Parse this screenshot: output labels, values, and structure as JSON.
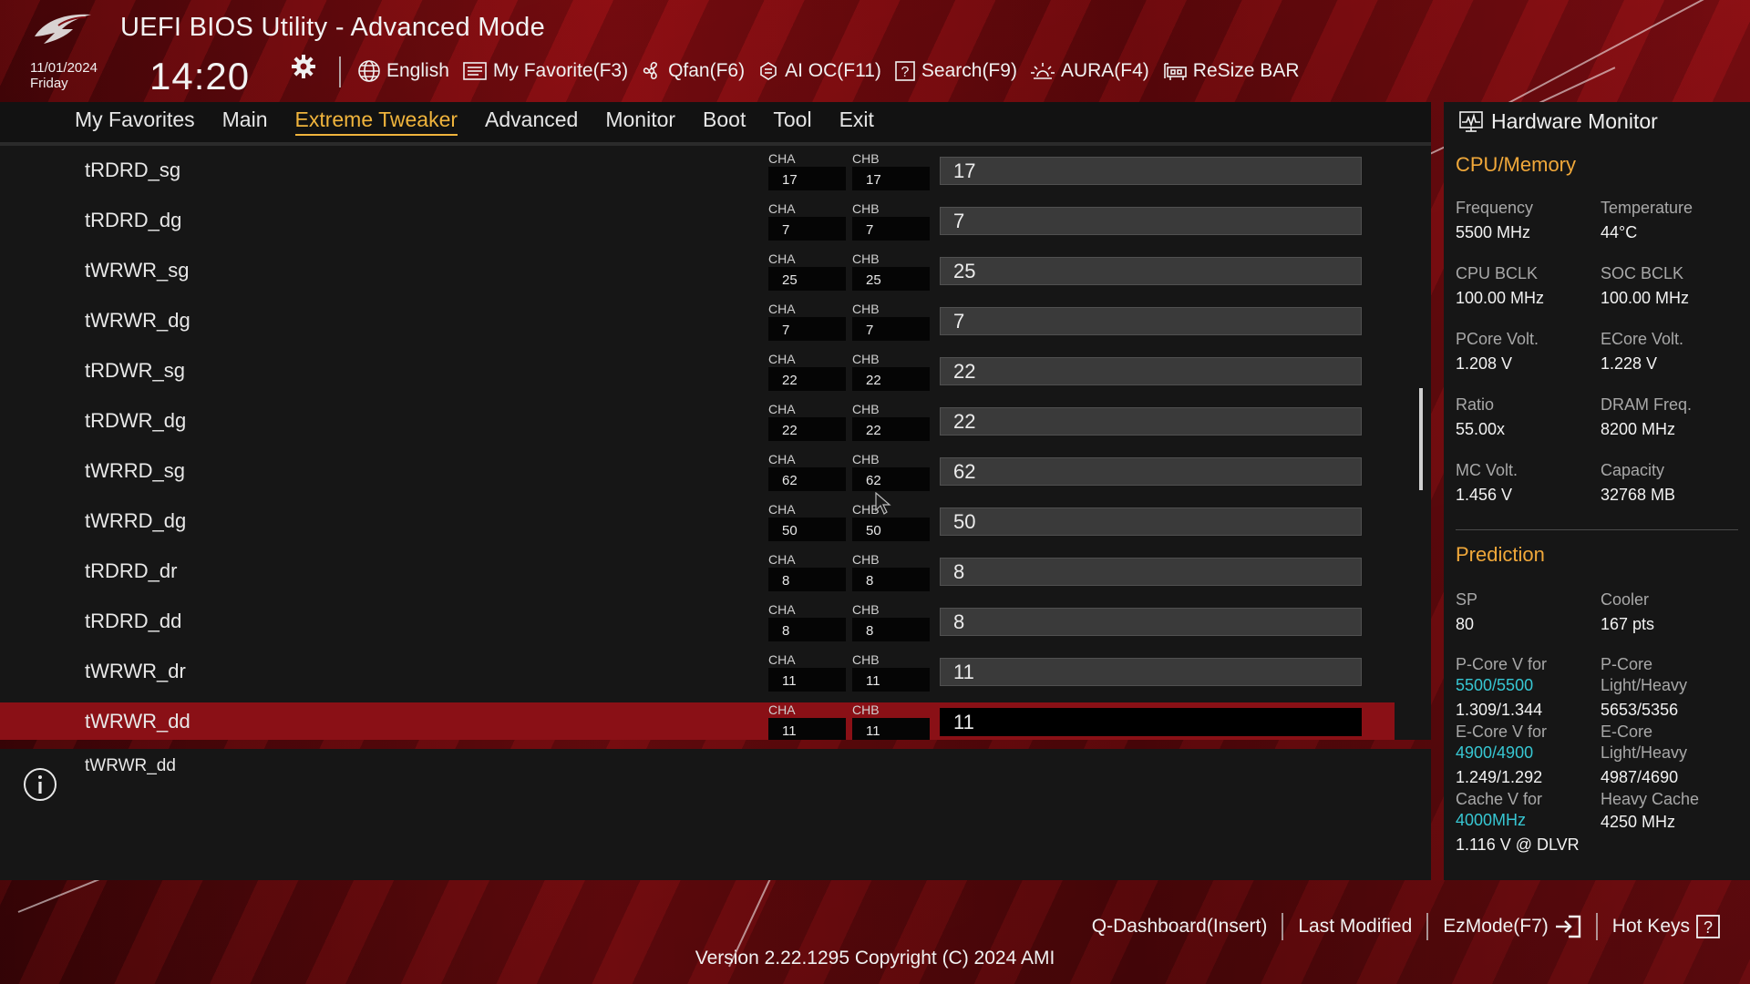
{
  "header": {
    "title": "UEFI BIOS Utility - Advanced Mode",
    "date": "11/01/2024",
    "day": "Friday",
    "time": "14:20",
    "tools": [
      {
        "label": "English",
        "icon": "globe-icon"
      },
      {
        "label": "My Favorite(F3)",
        "icon": "favorite-list-icon"
      },
      {
        "label": "Qfan(F6)",
        "icon": "fan-icon"
      },
      {
        "label": "AI OC(F11)",
        "icon": "ai-chip-icon"
      },
      {
        "label": "Search(F9)",
        "icon": "search-question-icon"
      },
      {
        "label": "AURA(F4)",
        "icon": "aura-light-icon"
      },
      {
        "label": "ReSize BAR",
        "icon": "resize-bar-icon"
      }
    ]
  },
  "nav": {
    "items": [
      "My Favorites",
      "Main",
      "Extreme Tweaker",
      "Advanced",
      "Monitor",
      "Boot",
      "Tool",
      "Exit"
    ],
    "active": "Extreme Tweaker"
  },
  "channels": {
    "a": "CHA",
    "b": "CHB"
  },
  "rows": [
    {
      "label": "tRDRD_sg",
      "cha": "17",
      "chb": "17",
      "value": "17"
    },
    {
      "label": "tRDRD_dg",
      "cha": "7",
      "chb": "7",
      "value": "7"
    },
    {
      "label": "tWRWR_sg",
      "cha": "25",
      "chb": "25",
      "value": "25"
    },
    {
      "label": "tWRWR_dg",
      "cha": "7",
      "chb": "7",
      "value": "7"
    },
    {
      "label": "tRDWR_sg",
      "cha": "22",
      "chb": "22",
      "value": "22"
    },
    {
      "label": "tRDWR_dg",
      "cha": "22",
      "chb": "22",
      "value": "22"
    },
    {
      "label": "tWRRD_sg",
      "cha": "62",
      "chb": "62",
      "value": "62"
    },
    {
      "label": "tWRRD_dg",
      "cha": "50",
      "chb": "50",
      "value": "50"
    },
    {
      "label": "tRDRD_dr",
      "cha": "8",
      "chb": "8",
      "value": "8"
    },
    {
      "label": "tRDRD_dd",
      "cha": "8",
      "chb": "8",
      "value": "8"
    },
    {
      "label": "tWRWR_dr",
      "cha": "11",
      "chb": "11",
      "value": "11"
    },
    {
      "label": "tWRWR_dd",
      "cha": "11",
      "chb": "11",
      "value": "11",
      "selected": true
    }
  ],
  "help": {
    "text": "tWRWR_dd"
  },
  "hw": {
    "title": "Hardware Monitor",
    "cpu_section": "CPU/Memory",
    "cpu": [
      {
        "label": "Frequency",
        "value": "5500 MHz"
      },
      {
        "label": "Temperature",
        "value": "44°C"
      },
      {
        "label": "CPU BCLK",
        "value": "100.00 MHz"
      },
      {
        "label": "SOC BCLK",
        "value": "100.00 MHz"
      },
      {
        "label": "PCore Volt.",
        "value": "1.208 V"
      },
      {
        "label": "ECore Volt.",
        "value": "1.228 V"
      },
      {
        "label": "Ratio",
        "value": "55.00x"
      },
      {
        "label": "DRAM Freq.",
        "value": "8200 MHz"
      },
      {
        "label": "MC Volt.",
        "value": "1.456 V"
      },
      {
        "label": "Capacity",
        "value": "32768 MB"
      }
    ],
    "prediction_section": "Prediction",
    "sp_label": "SP",
    "sp_value": "80",
    "cooler_label": "Cooler",
    "cooler_value": "167 pts",
    "pcore_v_label": "P-Core V for",
    "pcore_v_freq": "5500/5500",
    "pcore_v_value": "1.309/1.344",
    "pcore_lh_label1": "P-Core",
    "pcore_lh_label2": "Light/Heavy",
    "pcore_lh_value": "5653/5356",
    "ecore_v_label": "E-Core V for",
    "ecore_v_freq": "4900/4900",
    "ecore_v_value": "1.249/1.292",
    "ecore_lh_label1": "E-Core",
    "ecore_lh_label2": "Light/Heavy",
    "ecore_lh_value": "4987/4690",
    "cache_v_label": "Cache V for",
    "cache_v_freq": "4000MHz",
    "cache_v_value": "1.116 V @ DLVR",
    "heavy_cache_label": "Heavy Cache",
    "heavy_cache_value": "4250 MHz"
  },
  "footer": {
    "links": [
      "Q-Dashboard(Insert)",
      "Last Modified",
      "EzMode(F7)",
      "Hot Keys"
    ],
    "version": "Version 2.22.1295 Copyright (C) 2024 AMI"
  },
  "colors": {
    "accent": "#f0b43c",
    "selected_row": "#8a1016",
    "cyan": "#37c7d3",
    "section": "#f0a83a"
  }
}
